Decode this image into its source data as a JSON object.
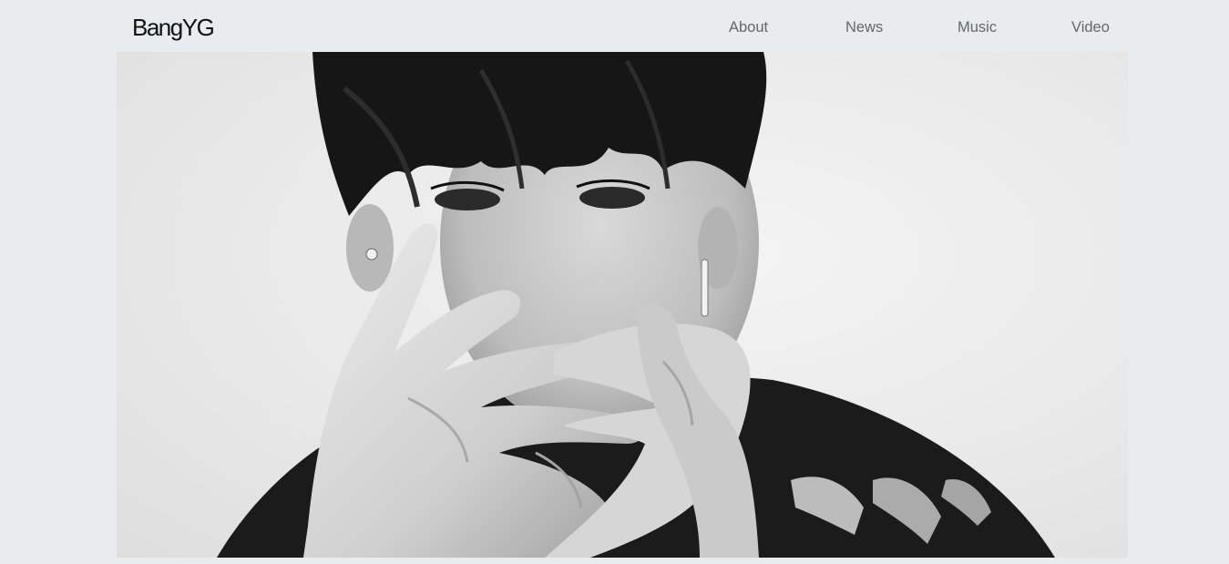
{
  "header": {
    "logo": "BangYG",
    "nav": [
      {
        "label": "About"
      },
      {
        "label": "News"
      },
      {
        "label": "Music"
      },
      {
        "label": "Video"
      }
    ]
  },
  "hero": {
    "image": "black-and-white portrait photo",
    "colors": {
      "background": "#e8ecef",
      "photo_bg": "#ececec",
      "hair": "#151515"
    }
  }
}
